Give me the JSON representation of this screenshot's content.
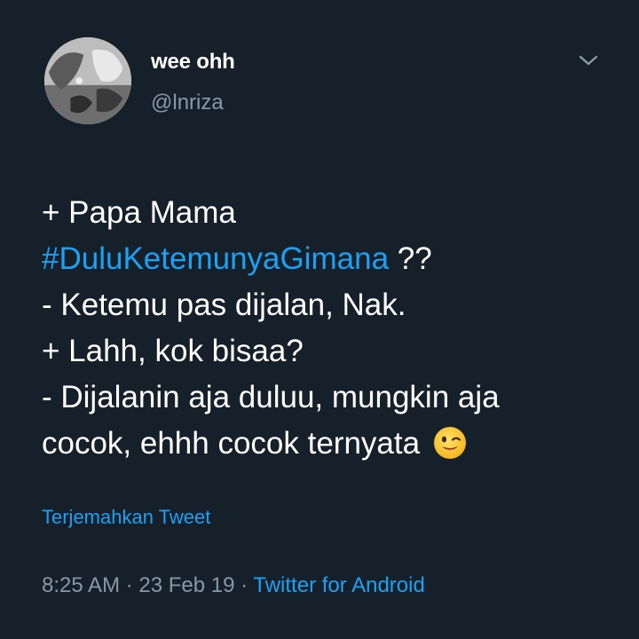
{
  "user": {
    "display_name": "wee ohh",
    "handle": "@lnriza"
  },
  "icons": {
    "menu": "chevron-down-icon",
    "emoji": "winking-face-emoji"
  },
  "tweet": {
    "line1": "+ Papa Mama",
    "hashtag": "#DuluKetemunyaGimana",
    "line2_suffix": " ??",
    "line3": "- Ketemu pas dijalan, Nak.",
    "line4": "+ Lahh, kok bisaa?",
    "line5": "- Dijalanin aja duluu, mungkin aja",
    "line6": "cocok, ehhh cocok ternyata"
  },
  "translate_label": "Terjemahkan Tweet",
  "meta": {
    "time": "8:25 AM",
    "separator1": " · ",
    "date": "23 Feb 19",
    "separator2": " · ",
    "source": "Twitter for Android"
  },
  "colors": {
    "background": "#15202b",
    "text": "#ffffff",
    "secondary": "#8899a6",
    "accent": "#1da1f2"
  }
}
